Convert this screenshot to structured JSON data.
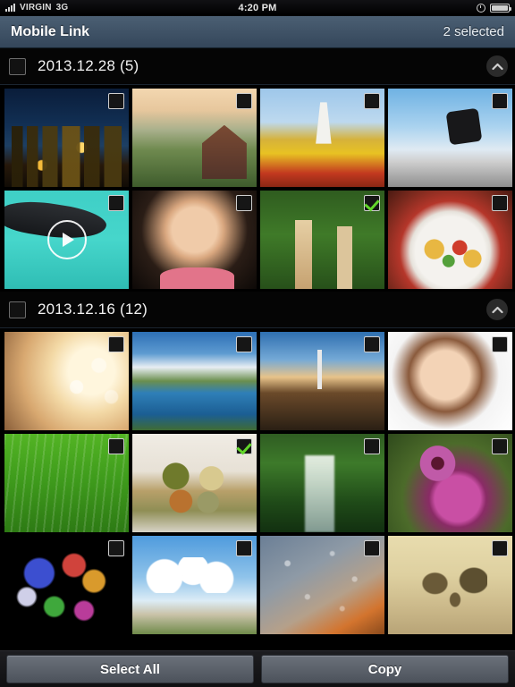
{
  "statusbar": {
    "carrier": "VIRGIN",
    "network": "3G",
    "time": "4:20 PM",
    "alarm_icon": "alarm-clock-icon",
    "battery_icon": "battery-full-icon",
    "signal_icon": "signal-bars-icon"
  },
  "titlebar": {
    "title": "Mobile Link",
    "selected_label": "2 selected"
  },
  "toolbar": {
    "select_all_label": "Select All",
    "copy_label": "Copy"
  },
  "colors": {
    "titlebar_top": "#4b5f73",
    "titlebar_bottom": "#34465a",
    "background": "#000000",
    "check_green": "#63d62b",
    "button_top": "#6b717a",
    "button_bottom": "#4c525b"
  },
  "sections": [
    {
      "id": "section-2013-12-28",
      "title": "2013.12.28 (5)",
      "date": "2013.12.28",
      "count": 5,
      "header_checked": false,
      "collapse_icon": "chevron-up-icon",
      "items": [
        {
          "name": "city-skyline-night",
          "art": "a-city",
          "checked": false,
          "video": false
        },
        {
          "name": "hillside-cottage",
          "art": "a-hill",
          "checked": false,
          "video": false
        },
        {
          "name": "windmill-tulips",
          "art": "a-mill",
          "checked": false,
          "video": false
        },
        {
          "name": "skateboarder-jump",
          "art": "a-skate",
          "checked": false,
          "video": false
        },
        {
          "name": "penguin-video",
          "art": "a-penguin",
          "checked": false,
          "video": true
        },
        {
          "name": "smiling-girl",
          "art": "a-girl",
          "checked": false,
          "video": false
        },
        {
          "name": "two-giraffes",
          "art": "a-giraffe",
          "checked": true,
          "video": false
        },
        {
          "name": "pasta-salad",
          "art": "a-pasta",
          "checked": false,
          "video": false
        }
      ]
    },
    {
      "id": "section-2013-12-16",
      "title": "2013.12.16 (12)",
      "date": "2013.12.16",
      "count": 12,
      "header_checked": false,
      "collapse_icon": "chevron-up-icon",
      "items": [
        {
          "name": "woman-blowing-bubbles",
          "art": "a-bubbles",
          "checked": false,
          "video": false
        },
        {
          "name": "mountain-lake",
          "art": "a-lake",
          "checked": false,
          "video": false
        },
        {
          "name": "wind-turbine-road",
          "art": "a-wind",
          "checked": false,
          "video": false
        },
        {
          "name": "portrait-woman",
          "art": "a-woman",
          "checked": false,
          "video": false
        },
        {
          "name": "green-grass-dew",
          "art": "a-grass",
          "checked": false,
          "video": false
        },
        {
          "name": "family-in-bed",
          "art": "a-family",
          "checked": true,
          "video": false
        },
        {
          "name": "mossy-waterfall",
          "art": "a-falls",
          "checked": false,
          "video": false
        },
        {
          "name": "pink-coneflowers",
          "art": "a-flower",
          "checked": false,
          "video": false
        },
        {
          "name": "fireworks",
          "art": "a-fire",
          "checked": false,
          "video": false
        },
        {
          "name": "blue-sky-clouds",
          "art": "a-sky",
          "checked": false,
          "video": false
        },
        {
          "name": "water-droplets",
          "art": "a-rain",
          "checked": false,
          "video": false
        },
        {
          "name": "family-on-beach",
          "art": "a-beach",
          "checked": false,
          "video": false
        }
      ]
    }
  ]
}
